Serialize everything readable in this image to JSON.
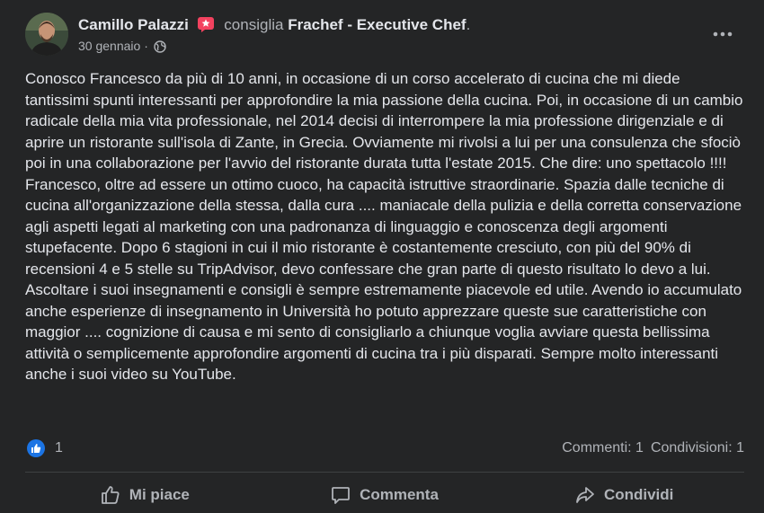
{
  "post": {
    "author": "Camillo Palazzi",
    "verb": "consiglia",
    "page_name": "Frachef - Executive Chef",
    "page_suffix": ".",
    "date": "30 gennaio",
    "date_separator": "·",
    "privacy_icon": "globe-icon",
    "options_icon": "more-options-icon",
    "text": "Conosco Francesco da più di 10 anni, in occasione di un corso accelerato di cucina che mi diede tantissimi spunti interessanti per approfondire la mia passione della cucina. Poi, in occasione di un cambio radicale della mia vita professionale, nel 2014 decisi di interrompere la mia professione dirigenziale e di aprire un ristorante sull'isola di Zante, in Grecia. Ovviamente mi rivolsi a lui per una consulenza che sfociò poi in una collaborazione per l'avvio del ristorante durata tutta l'estate 2015. Che dire: uno spettacolo !!!! Francesco, oltre ad essere un ottimo cuoco, ha capacità istruttive straordinarie. Spazia dalle tecniche di cucina all'organizzazione della stessa, dalla cura .... maniacale della pulizia e della corretta conservazione agli aspetti legati al marketing con una padronanza di linguaggio e conoscenza degli argomenti stupefacente. Dopo 6 stagioni in cui il mio ristorante è costantemente cresciuto, con più del 90% di recensioni 4 e 5 stelle su TripAdvisor, devo confessare che gran parte di questo risultato lo devo a lui. Ascoltare i suoi insegnamenti e consigli è sempre estremamente piacevole ed utile. Avendo io accumulato anche esperienze di insegnamento in Università ho potuto apprezzare queste sue caratteristiche con maggior .... cognizione di causa e mi sento di consigliarlo a chiunque voglia avviare questa bellissima attività o semplicemente approfondire argomenti di cucina tra i più disparati. Sempre molto interessanti anche i suoi video su YouTube."
  },
  "stats": {
    "likes": "1",
    "comments": "Commenti: 1",
    "shares": "Condivisioni: 1"
  },
  "actions": {
    "like": "Mi piace",
    "comment": "Commenta",
    "share": "Condividi"
  },
  "colors": {
    "background": "#242526",
    "primary_text": "#e4e6eb",
    "secondary_text": "#b0b3b8",
    "like_blue": "#1b74e4",
    "badge_pink": "#f3425f"
  }
}
